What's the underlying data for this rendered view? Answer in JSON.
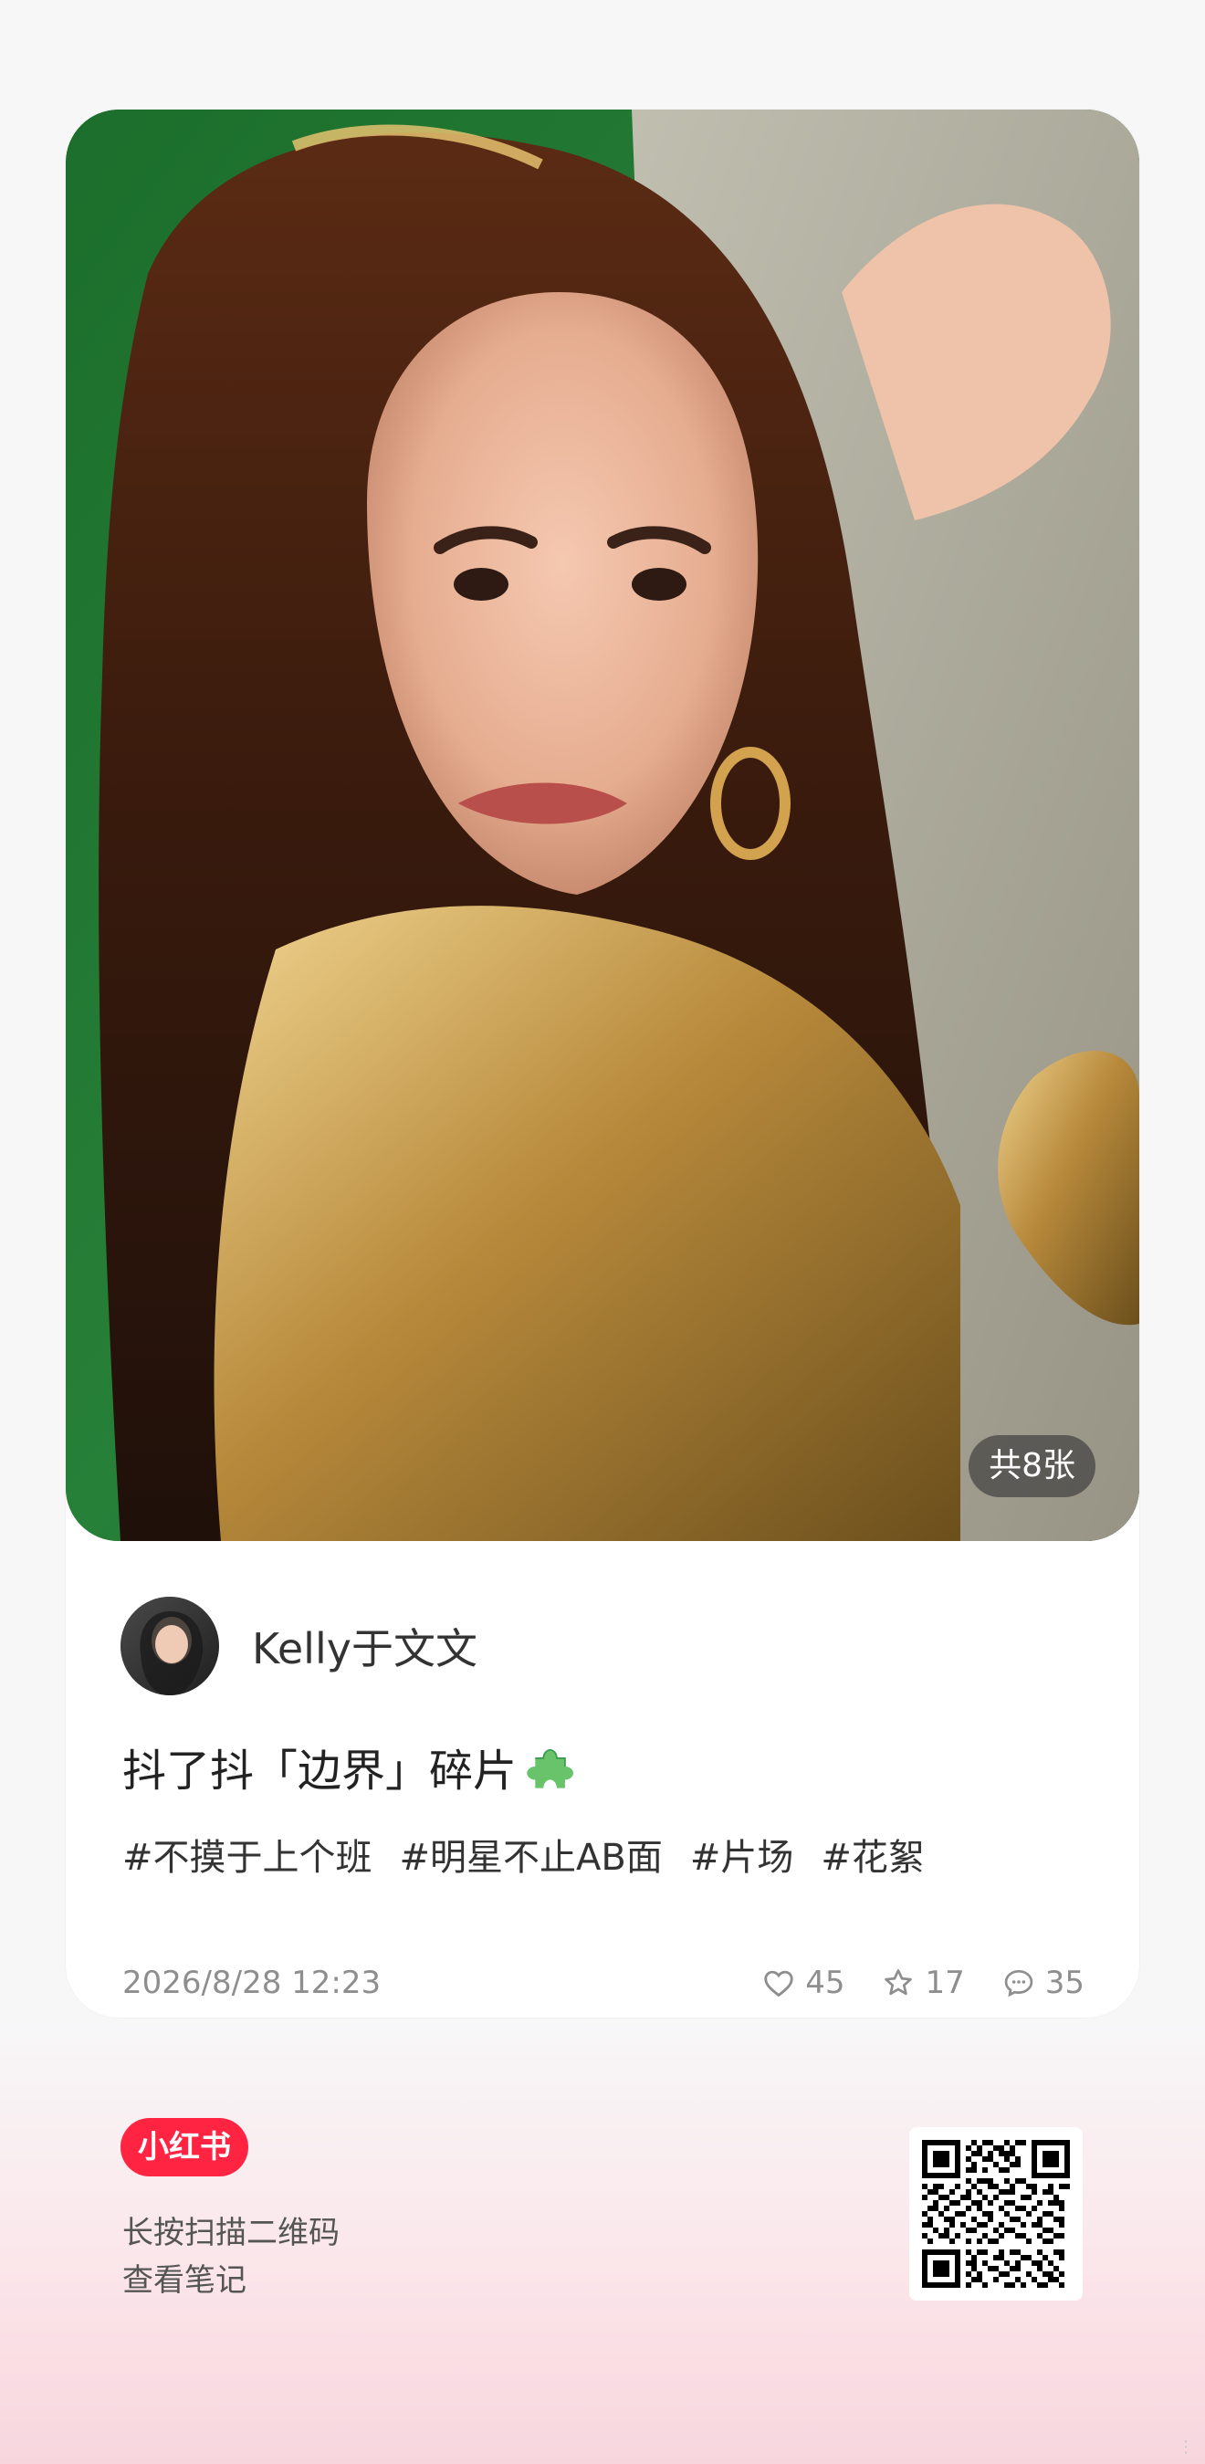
{
  "photo": {
    "count_label": "共8张"
  },
  "author": {
    "name": "Kelly于文文"
  },
  "note": {
    "title": "抖了抖「边界」碎片",
    "tags": [
      "#不摸于上个班",
      "#明星不止AB面",
      "#片场",
      "#花絮"
    ],
    "date": "2026/8/28 12:23",
    "likes": "45",
    "favorites": "17",
    "comments": "35"
  },
  "footer": {
    "brand": "小红书",
    "line1": "长按扫描二维码",
    "line2": "查看笔记"
  },
  "icons": {
    "like": "heart-icon",
    "favorite": "star-icon",
    "comment": "comment-icon",
    "title_emoji": "puzzle-piece-icon"
  },
  "colors": {
    "brand": "#ff2442",
    "background": "#f7f7f8",
    "footer_tint": "#f8d6de"
  }
}
